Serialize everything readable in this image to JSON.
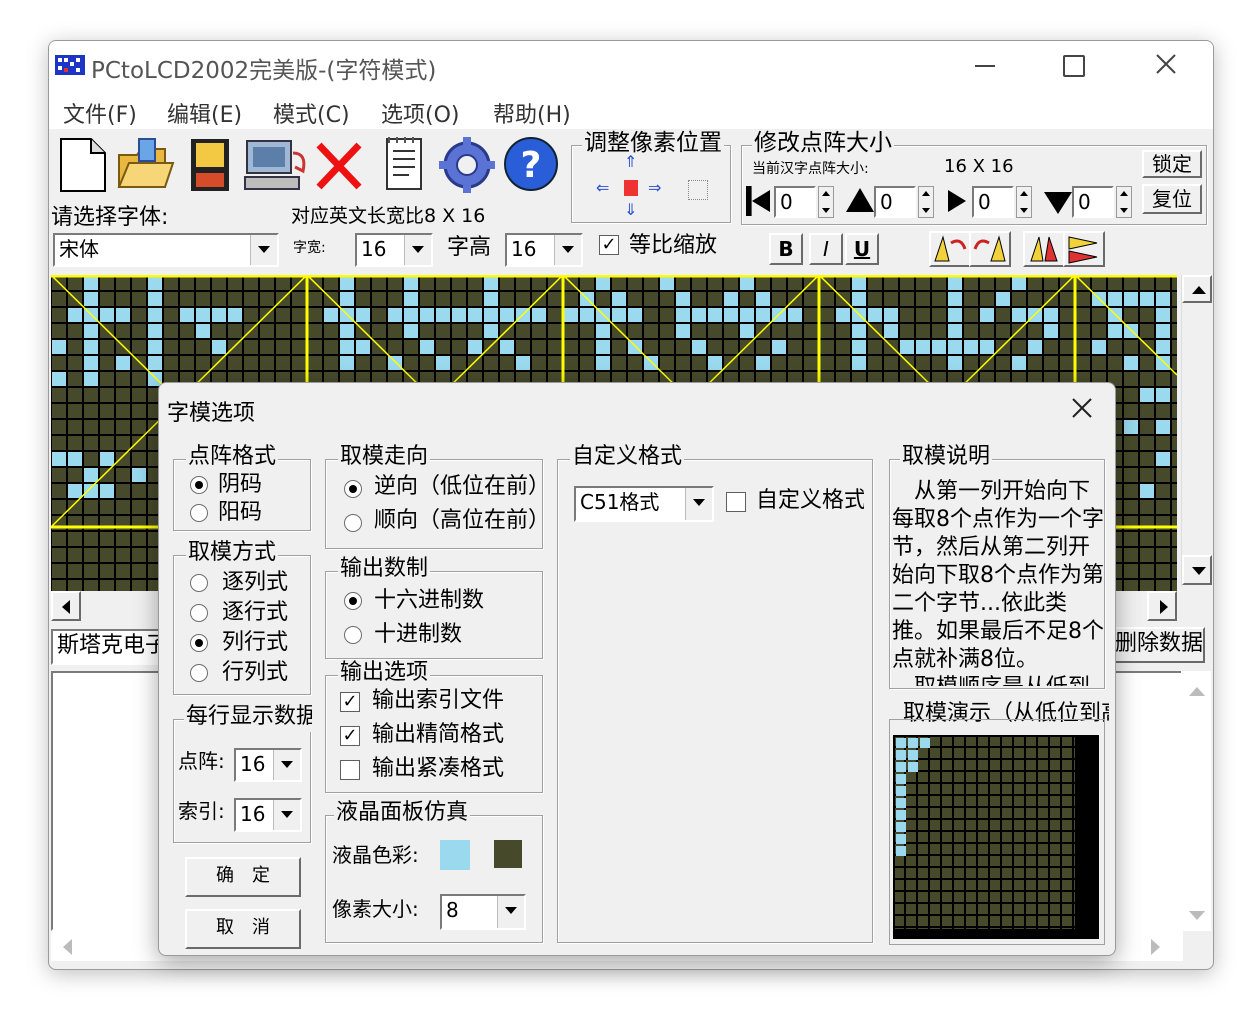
{
  "app": {
    "title": "PCtoLCD2002完美版-(字符模式)",
    "menu": [
      "文件(F)",
      "编辑(E)",
      "模式(C)",
      "选项(O)",
      "帮助(H)"
    ]
  },
  "toolbar": {
    "font_prompt": "请选择字体:",
    "font_value": "宋体",
    "ratio_text": "对应英文长宽比8 X 16",
    "width_label": "字宽:",
    "width_value": "16",
    "height_label": "字高",
    "height_value": "16",
    "proportional_label": "等比缩放",
    "proportional_checked": true,
    "bold": "B",
    "italic": "I",
    "underline": "U"
  },
  "pixel_adjust": {
    "title": "调整像素位置"
  },
  "matrix_size": {
    "title": "修改点阵大小",
    "current_label": "当前汉字点阵大小:",
    "current_value": "16 X 16",
    "lock_button": "锁定",
    "reset_button": "复位",
    "offsets": [
      "0",
      "0",
      "0",
      "0"
    ]
  },
  "bottom": {
    "input_text": "斯塔克电子",
    "delete_button": "删除数据"
  },
  "colors": {
    "lcd_on": "#9ad9ee",
    "lcd_off": "#474a2a",
    "grid_line": "#ffff00"
  },
  "dialog": {
    "title": "字模选项",
    "dot_format": {
      "title": "点阵格式",
      "options": [
        "阴码",
        "阳码"
      ],
      "selected": 0
    },
    "mode": {
      "title": "取模方式",
      "options": [
        "逐列式",
        "逐行式",
        "列行式",
        "行列式"
      ],
      "selected": 2
    },
    "per_line": {
      "title": "每行显示数据",
      "dot_label": "点阵:",
      "dot_value": "16",
      "index_label": "索引:",
      "index_value": "16"
    },
    "ok_button": "确　定",
    "cancel_button": "取　消",
    "direction": {
      "title": "取模走向",
      "options": [
        "逆向（低位在前）",
        "顺向（高位在前）"
      ],
      "selected": 0
    },
    "radix": {
      "title": "输出数制",
      "options": [
        "十六进制数",
        "十进制数"
      ],
      "selected": 0
    },
    "output_options": {
      "title": "输出选项",
      "items": [
        {
          "label": "输出索引文件",
          "checked": true
        },
        {
          "label": "输出精简格式",
          "checked": true
        },
        {
          "label": "输出紧凑格式",
          "checked": false
        }
      ]
    },
    "lcd_sim": {
      "title": "液晶面板仿真",
      "color_label": "液晶色彩:",
      "pixel_label": "像素大小:",
      "pixel_value": "8"
    },
    "custom_format": {
      "title": "自定义格式",
      "select_value": "C51格式",
      "checkbox_label": "自定义格式",
      "checked": false
    },
    "description": {
      "title": "取模说明",
      "text": "　从第一列开始向下每取8个点作为一个字节，然后从第二列开始向下取8个点作为第二个字节...依此类推。如果最后不足8个点就补满8位。\n　取模顺序是从低到高"
    },
    "demo": {
      "title": "取模演示（从低位到高位）"
    }
  }
}
